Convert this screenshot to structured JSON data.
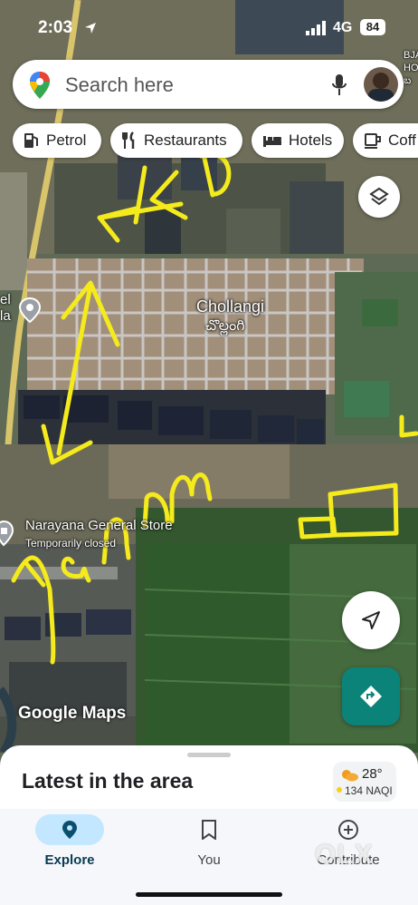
{
  "status_bar": {
    "time": "2:03",
    "network": "4G",
    "battery": "84"
  },
  "search": {
    "placeholder": "Search here"
  },
  "chips": [
    {
      "label": "Petrol",
      "icon": "fuel-icon"
    },
    {
      "label": "Restaurants",
      "icon": "fork-knife-icon"
    },
    {
      "label": "Hotels",
      "icon": "bed-icon"
    },
    {
      "label": "Coff",
      "icon": "coffee-cup-icon"
    }
  ],
  "map": {
    "place_name": "Chollangi",
    "place_name_local": "చొల్లంగి",
    "store_name": "Narayana General Store",
    "store_status": "Temporarily closed",
    "edge_label_1": "el",
    "edge_label_2": "la",
    "edge_label_right": "BJA\nHO\nబ",
    "branding": "Google Maps",
    "annotations": {
      "kd": "KD",
      "yanam": "Yanam"
    }
  },
  "sheet": {
    "title": "Latest in the area"
  },
  "weather": {
    "temperature": "28°",
    "aqi": "134 NAQI"
  },
  "nav": [
    {
      "label": "Explore",
      "icon": "explore-pin-icon",
      "active": true
    },
    {
      "label": "You",
      "icon": "bookmark-icon",
      "active": false
    },
    {
      "label": "Contribute",
      "icon": "plus-circle-icon",
      "active": false
    }
  ],
  "watermark": "OLX",
  "colors": {
    "accent_teal": "#0b8379",
    "annotation_yellow": "#f4ea1c",
    "explore_pill": "#c2e7ff"
  }
}
